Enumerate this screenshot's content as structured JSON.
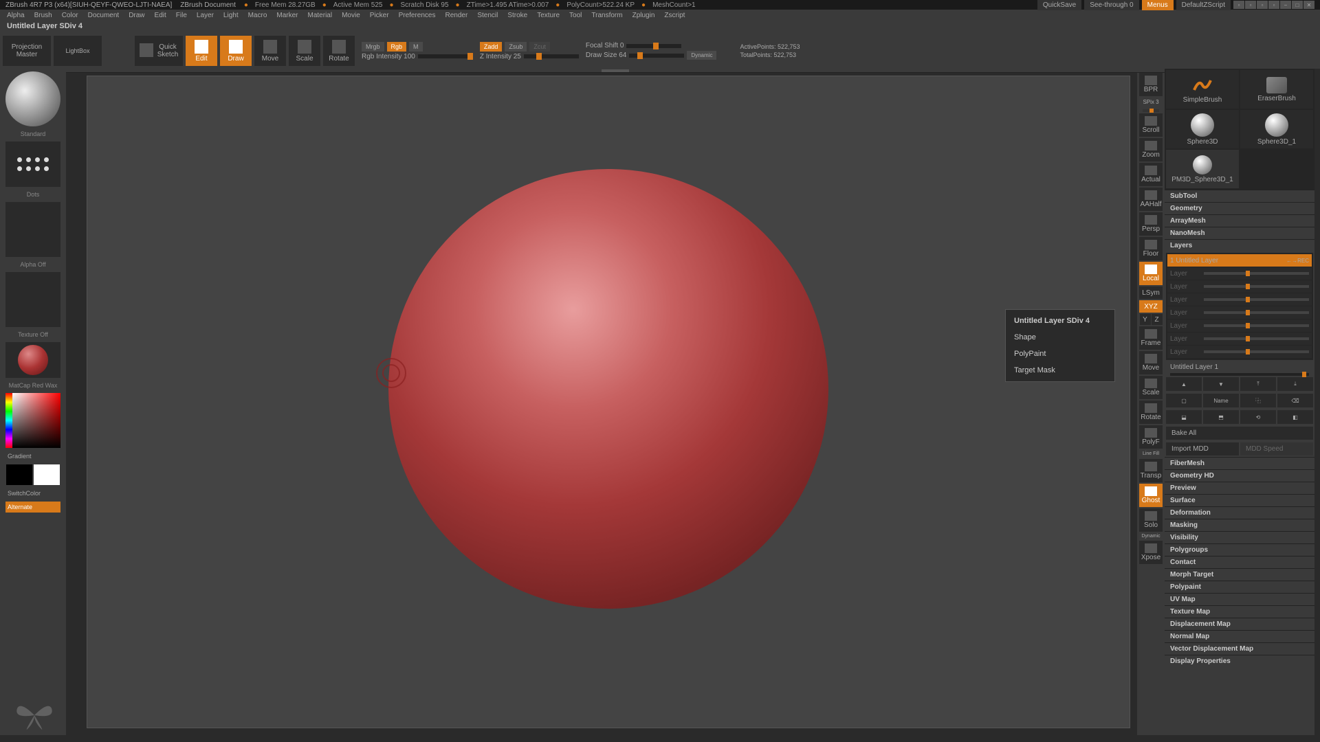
{
  "title_bar": {
    "app": "ZBrush 4R7 P3 (x64)[SIUH-QEYF-QWEO-LJTI-NAEA]",
    "doc": "ZBrush Document",
    "free_mem": "Free Mem 28.27GB",
    "active_mem": "Active Mem 525",
    "scratch": "Scratch Disk 95",
    "ztime": "ZTime>1.495 ATime>0.007",
    "polycount": "PolyCount>522.24 KP",
    "meshcount": "MeshCount>1",
    "quicksave": "QuickSave",
    "seethrough": "See-through  0",
    "menus": "Menus",
    "default": "DefaultZScript"
  },
  "menus": [
    "Alpha",
    "Brush",
    "Color",
    "Document",
    "Draw",
    "Edit",
    "File",
    "Layer",
    "Light",
    "Macro",
    "Marker",
    "Material",
    "Movie",
    "Picker",
    "Preferences",
    "Render",
    "Stencil",
    "Stroke",
    "Texture",
    "Tool",
    "Transform",
    "Zplugin",
    "Zscript"
  ],
  "doc_title": "Untitled Layer SDiv 4",
  "toolbar": {
    "projection_master": "Projection\nMaster",
    "lightbox": "LightBox",
    "quick_sketch": "Quick\nSketch",
    "edit": "Edit",
    "draw": "Draw",
    "move": "Move",
    "scale": "Scale",
    "rotate": "Rotate",
    "mrgb": "Mrgb",
    "rgb": "Rgb",
    "m": "M",
    "rgb_intensity": "Rgb Intensity 100",
    "zadd": "Zadd",
    "zsub": "Zsub",
    "zcut": "Zcut",
    "z_intensity": "Z Intensity 25",
    "focal_shift": "Focal Shift 0",
    "draw_size": "Draw Size 64",
    "dynamic": "Dynamic",
    "active_points": "ActivePoints: 522,753",
    "total_points": "TotalPoints: 522,753"
  },
  "left": {
    "brush": "Standard",
    "stroke": "Dots",
    "alpha": "Alpha Off",
    "texture": "Texture Off",
    "material": "MatCap Red Wax",
    "gradient": "Gradient",
    "switch": "SwitchColor",
    "alternate": "Alternate"
  },
  "right_tools": [
    "BPR",
    "SPix 3",
    "Scroll",
    "Zoom",
    "Actual",
    "AAHalf",
    "Persp",
    "Floor",
    "Local",
    "LSym",
    "XYZ",
    "Y",
    "Z",
    "Frame",
    "Move",
    "Scale",
    "Rotate",
    "PolyF",
    "Line Fill",
    "Transp",
    "Ghost",
    "Solo",
    "Dynamic",
    "Xpose"
  ],
  "popup": {
    "title": "Untitled Layer SDiv 4",
    "rows": [
      "Shape",
      "PolyPaint",
      "Target Mask"
    ]
  },
  "tools": {
    "items": [
      "SimpleBrush",
      "EraserBrush",
      "Sphere3D",
      "Sphere3D_1",
      "PM3D_Sphere3D_1"
    ]
  },
  "palettes": {
    "subtool": "SubTool",
    "geometry": "Geometry",
    "arraymesh": "ArrayMesh",
    "nanomesh": "NanoMesh",
    "layers": "Layers",
    "layer_active": "1 Untitled Layer",
    "layer_name_label": "Untitled Layer 1",
    "name_btn": "Name",
    "bake_all": "Bake All",
    "import_mdd": "Import MDD",
    "mdd_speed": "MDD Speed",
    "list": [
      "FiberMesh",
      "Geometry HD",
      "Preview",
      "Surface",
      "Deformation",
      "Masking",
      "Visibility",
      "Polygroups",
      "Contact",
      "Morph Target",
      "Polypaint",
      "UV Map",
      "Texture Map",
      "Displacement Map",
      "Normal Map",
      "Vector Displacement Map",
      "Display Properties"
    ]
  }
}
